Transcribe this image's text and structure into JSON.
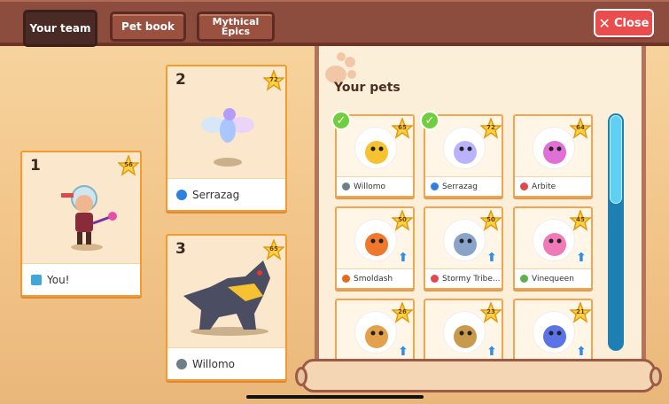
{
  "tabs": [
    {
      "label": "Your team"
    },
    {
      "label": "Pet book"
    },
    {
      "label": "Mythical Epics"
    }
  ],
  "close_label": "Close",
  "team": [
    {
      "slot": "1",
      "level": "56",
      "name": "You!",
      "element": "player"
    },
    {
      "slot": "2",
      "level": "72",
      "name": "Serrazag",
      "element": "water"
    },
    {
      "slot": "3",
      "level": "65",
      "name": "Willomo",
      "element": "air"
    }
  ],
  "pets_title": "Your pets",
  "pets": [
    {
      "name": "Willomo",
      "level": "65",
      "element": "air",
      "in_team": true
    },
    {
      "name": "Serrazag",
      "level": "72",
      "element": "water",
      "in_team": true
    },
    {
      "name": "Arbite",
      "level": "64",
      "element": "storm",
      "in_team": false
    },
    {
      "name": "Smoldash",
      "level": "50",
      "element": "fire",
      "in_team": false
    },
    {
      "name": "Stormy Tribe...",
      "level": "50",
      "element": "storm",
      "in_team": false
    },
    {
      "name": "Vinequeen",
      "level": "45",
      "element": "earth",
      "in_team": false
    },
    {
      "name": "",
      "level": "26",
      "element": "",
      "in_team": false
    },
    {
      "name": "",
      "level": "23",
      "element": "",
      "in_team": false
    },
    {
      "name": "",
      "level": "21",
      "element": "",
      "in_team": false
    }
  ],
  "scroll_position": 0,
  "colors": {
    "accent": "#f39b2f",
    "close": "#e94d4e",
    "scrollbar": "#1e7fb2"
  }
}
